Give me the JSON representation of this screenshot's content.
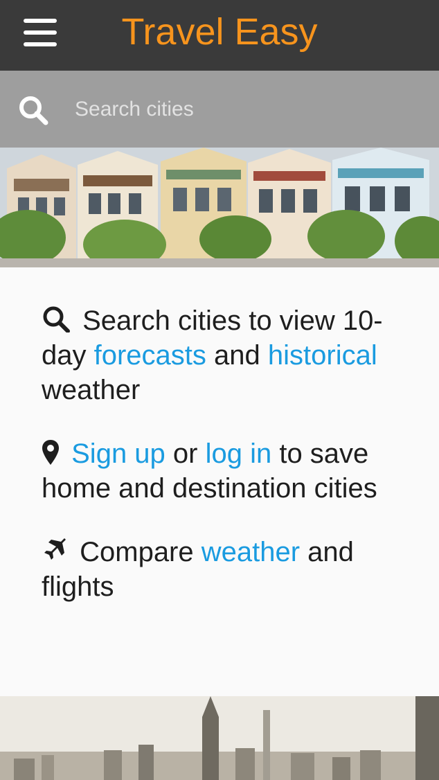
{
  "app": {
    "title": "Travel Easy"
  },
  "colors": {
    "accent": "#f7941d",
    "link": "#1a9be0",
    "topbar": "#3a3a3a",
    "searchbar": "#9e9e9e"
  },
  "icons": {
    "menu": "hamburger-icon",
    "search": "search-icon",
    "map_marker": "map-marker-icon",
    "plane": "plane-icon"
  },
  "search": {
    "placeholder": "Search cities"
  },
  "features": [
    {
      "icon": "search-icon",
      "t1": " Search cities to view 10-day ",
      "link1": "forecasts",
      "t2": " and ",
      "link2": "historical",
      "t3": " weather"
    },
    {
      "icon": "map-marker-icon",
      "t0": " ",
      "link1": "Sign up",
      "t1": " or ",
      "link2": "log in",
      "t2": " to save home and destination cities"
    },
    {
      "icon": "plane-icon",
      "t1": " Compare ",
      "link1": "weather",
      "t2": " and flights"
    }
  ]
}
